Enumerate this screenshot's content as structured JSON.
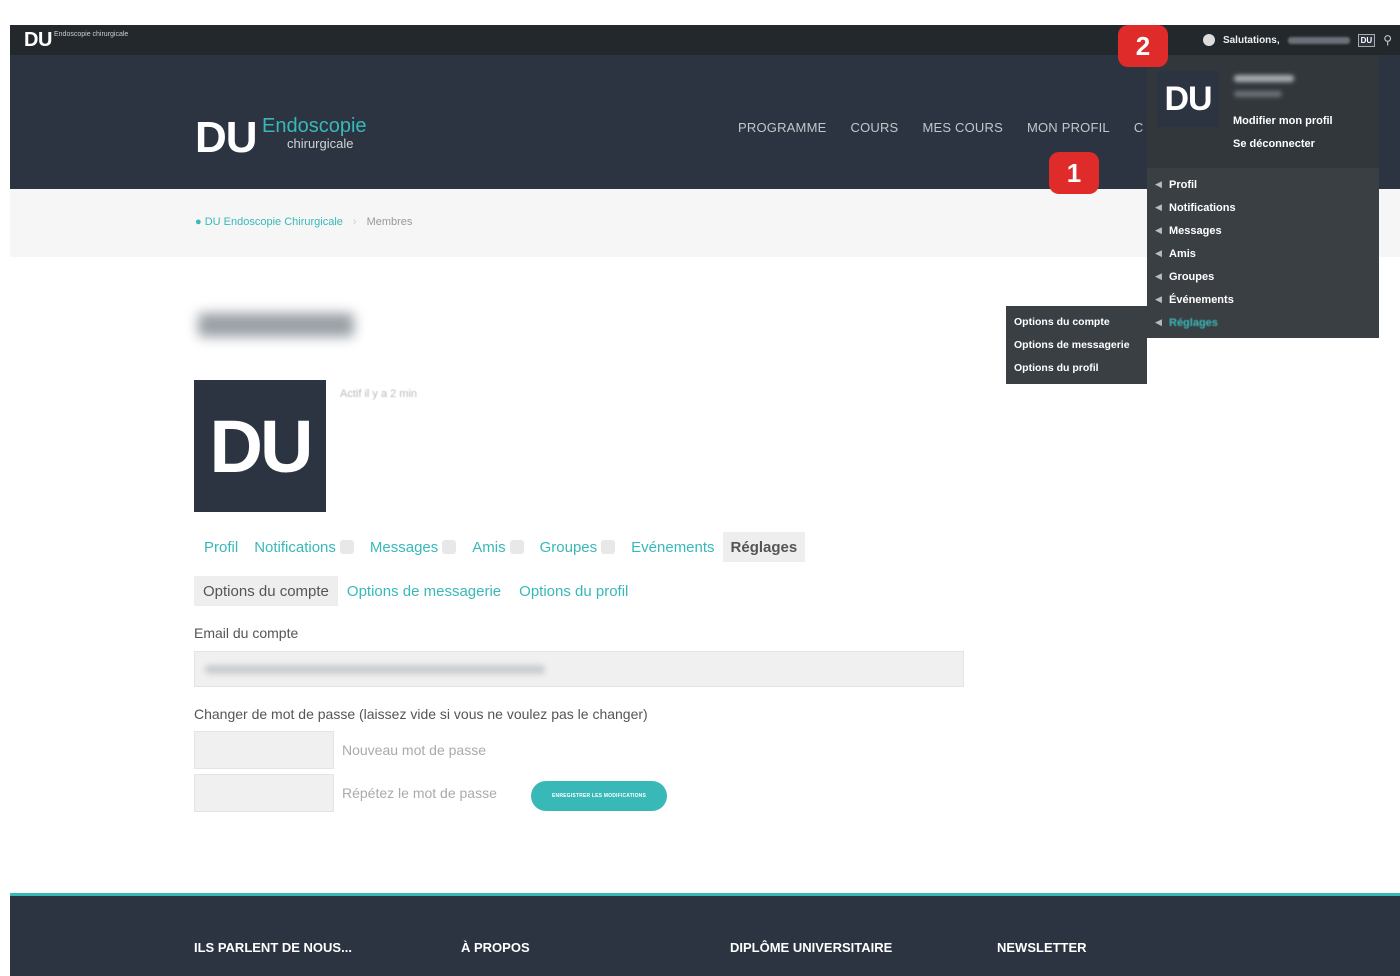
{
  "adminbar": {
    "logo": "DU",
    "logo_sub": "Endoscopie chirurgicale",
    "greeting": "Salutations,",
    "avatar_text": "DU",
    "search_icon": "search-icon"
  },
  "header": {
    "logo": "DU",
    "logo_endo": "Endoscopie",
    "logo_chir": "chirurgicale",
    "nav": [
      "PROGRAMME",
      "COURS",
      "MES COURS",
      "MON PROFIL",
      "C"
    ]
  },
  "breadcrumb": {
    "home": "DU Endoscopie Chirurgicale",
    "separator": "›",
    "current": "Membres"
  },
  "member": {
    "avatar_text": "DU",
    "activity": "Actif il y a 2 min"
  },
  "subnav": {
    "items": [
      "Profil",
      "Notifications",
      "Messages",
      "Amis",
      "Groupes",
      "Evénements",
      "Réglages"
    ]
  },
  "settings_tabs": {
    "items": [
      "Options du compte",
      "Options de messagerie",
      "Options du profil"
    ]
  },
  "form": {
    "email_label": "Email du compte",
    "password_label": "Changer de mot de passe (laissez vide si vous ne voulez pas le changer)",
    "new_password_label": "Nouveau mot de passe",
    "repeat_password_label": "Répétez le mot de passe",
    "save_label": "ENREGISTRER LES MODIFICATIONS"
  },
  "footer": {
    "columns": [
      "ILS PARLENT DE NOUS...",
      "À PROPOS",
      "DIPLÔME UNIVERSITAIRE",
      "NEWSLETTER"
    ]
  },
  "profile_dropdown": {
    "avatar_text": "DU",
    "edit_profile": "Modifier mon profil",
    "logout": "Se déconnecter",
    "items": [
      "Profil",
      "Notifications",
      "Messages",
      "Amis",
      "Groupes",
      "Événements",
      "Réglages"
    ]
  },
  "settings_dropdown": {
    "items": [
      "Options du compte",
      "Options de messagerie",
      "Options du profil"
    ]
  },
  "markers": {
    "one": "1",
    "two": "2"
  },
  "colors": {
    "accent": "#39b8b8",
    "header_bg": "#2b3440",
    "marker": "#e02b2b"
  }
}
